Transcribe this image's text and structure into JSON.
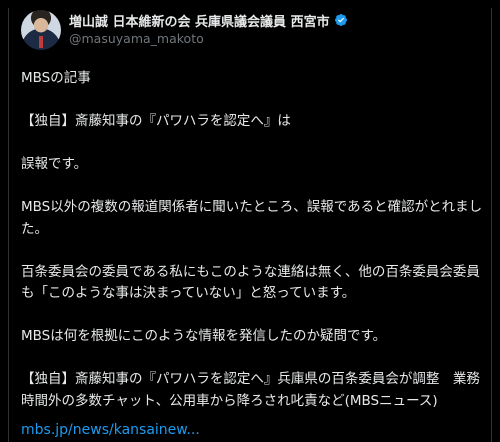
{
  "author": {
    "display_name": "増山誠 日本維新の会 兵庫県議会議員 西宮市",
    "handle": "@masuyama_makoto",
    "verified_color": "#1d9bf0"
  },
  "post": {
    "paragraphs": [
      "MBSの記事",
      "【独自】斎藤知事の『パワハラを認定へ』は",
      "誤報です。",
      "MBS以外の複数の報道関係者に聞いたところ、誤報であると確認がとれました。",
      "百条委員会の委員である私にもこのような連絡は無く、他の百条委員会委員も「このような事は決まっていない」と怒っています。",
      "MBSは何を根拠にこのような情報を発信したのか疑問です。",
      "【独自】斎藤知事の『パワハラを認定へ』兵庫県の百条委員会が調整　業務時間外の多数チャット、公用車から降ろされ叱責など(MBSニュース)"
    ],
    "link_text": "mbs.jp/news/kansainew..."
  },
  "colors": {
    "background": "#000000",
    "text": "#e7e9ea",
    "secondary": "#71767b",
    "accent": "#1d9bf0"
  }
}
